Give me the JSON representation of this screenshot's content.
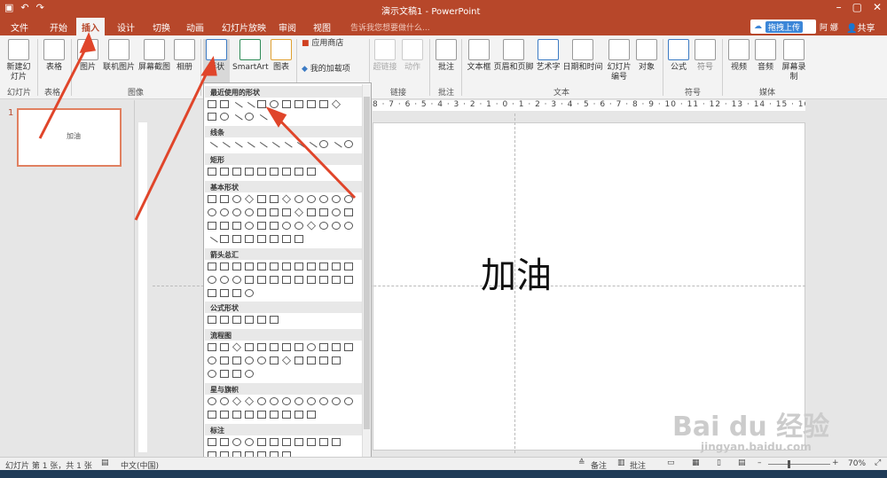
{
  "titlebar": {
    "title": "演示文稿1 - PowerPoint",
    "save_icon": "save-icon",
    "undo_icon": "undo-icon",
    "redo_icon": "redo-icon"
  },
  "tabs": [
    "文件",
    "开始",
    "插入",
    "设计",
    "切换",
    "动画",
    "幻灯片放映",
    "审阅",
    "视图"
  ],
  "active_tab": "插入",
  "tellme": "告诉我您想要做什么...",
  "cloud_button": {
    "label": "拖拽上传"
  },
  "user": "阿 娜",
  "share": "共享",
  "ribbon": {
    "groups": [
      "幻灯片",
      "表格",
      "图像",
      "链接",
      "批注",
      "文本",
      "符号",
      "媒体"
    ],
    "buttons": [
      "新建幻灯片",
      "表格",
      "图片",
      "联机图片",
      "屏幕截图",
      "相册",
      "形状",
      "SmartArt",
      "图表",
      "应用商店",
      "我的加载项",
      "超链接",
      "动作",
      "批注",
      "文本框",
      "页眉和页脚",
      "艺术字",
      "日期和时间",
      "幻灯片编号",
      "对象",
      "公式",
      "符号",
      "视频",
      "音频",
      "屏幕录制"
    ]
  },
  "slide_panel": {
    "number": "1",
    "thumb_text": "加油"
  },
  "slide": {
    "text": "加油"
  },
  "ruler_text": "8 · 7 · 6 · 5 · 4 · 3 · 2 · 1 · 0 · 1 · 2 · 3 · 4 · 5 · 6 · 7 · 8 · 9 · 10 · 11 · 12 · 13 · 14 · 15 · 16",
  "dropdown": {
    "sections": [
      "最近使用的形状",
      "线条",
      "矩形",
      "基本形状",
      "箭头总汇",
      "公式形状",
      "流程图",
      "星与旗帜",
      "标注"
    ]
  },
  "status": {
    "slide_info": "幻灯片 第 1 张，共 1 张",
    "language": "中文(中国)",
    "notes": "备注",
    "comments": "批注",
    "zoom": "70%"
  },
  "watermark": {
    "big": "Bai du 经验",
    "small": "jingyan.baidu.com"
  },
  "colors": {
    "accent": "#b7472a",
    "arrow": "#e0452a"
  }
}
